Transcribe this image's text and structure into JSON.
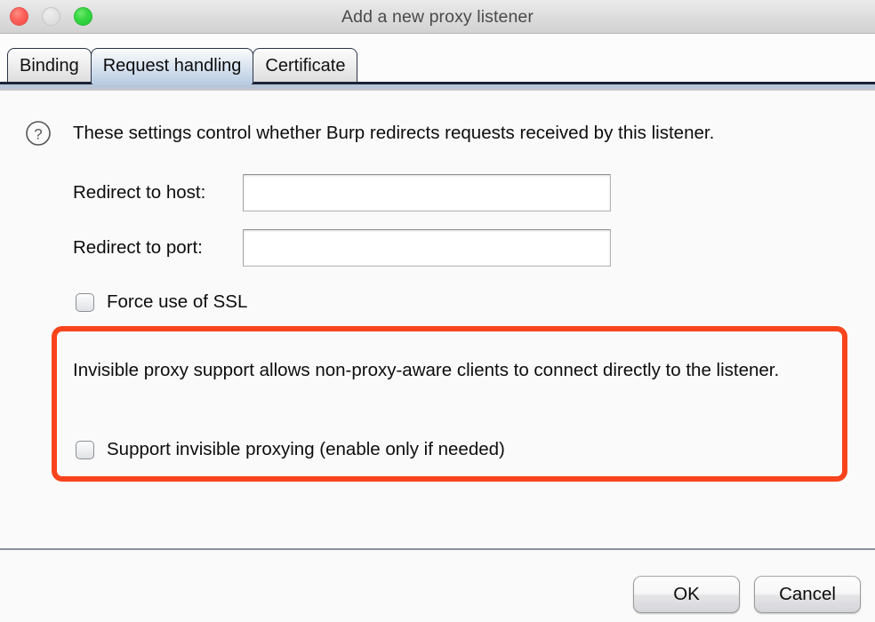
{
  "window": {
    "title": "Add a new proxy listener",
    "traffic_lights": [
      {
        "name": "close",
        "color": "#fb6059"
      },
      {
        "name": "minimize",
        "color": "#e2e2e2"
      },
      {
        "name": "maximize",
        "color": "#34d641"
      }
    ]
  },
  "tabs": [
    {
      "label": "Binding",
      "active": false
    },
    {
      "label": "Request handling",
      "active": true
    },
    {
      "label": "Certificate",
      "active": false
    }
  ],
  "panel": {
    "help_icon": "question-mark-circle-icon",
    "help_text": "These settings control whether Burp redirects requests received by this listener.",
    "fields": [
      {
        "label": "Redirect to host:",
        "value": "",
        "placeholder": ""
      },
      {
        "label": "Redirect to port:",
        "value": "",
        "placeholder": ""
      }
    ],
    "force_ssl": {
      "label": "Force use of SSL",
      "checked": false
    },
    "annotation": {
      "highlight_color": "#f8441c",
      "description": "Invisible proxy support allows non-proxy-aware clients to connect directly to the listener.",
      "checkbox": {
        "label": "Support invisible proxying (enable only if needed)",
        "checked": false
      }
    }
  },
  "footer": {
    "ok_label": "OK",
    "cancel_label": "Cancel"
  }
}
